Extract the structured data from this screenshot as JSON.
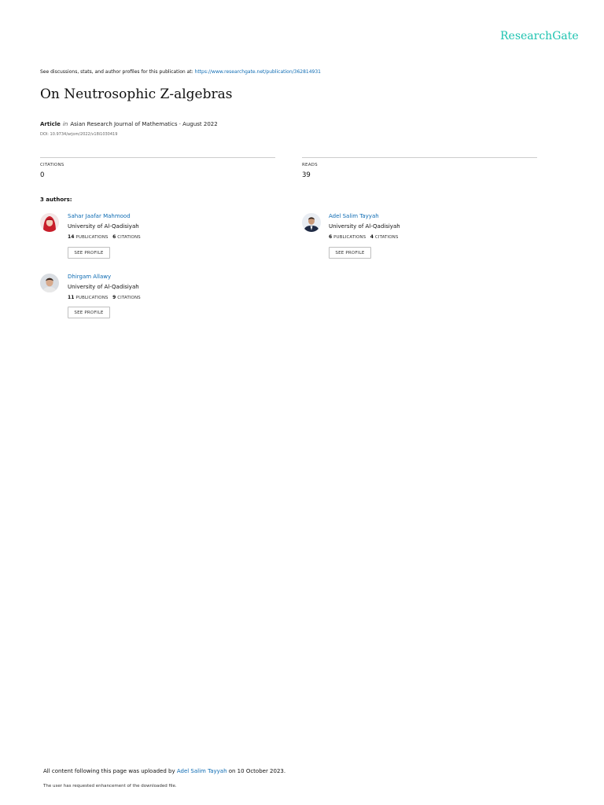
{
  "brand": {
    "logo_text": "ResearchGate",
    "color": "#1ec3b0"
  },
  "discussion": {
    "prefix": "See discussions, stats, and author profiles for this publication at: ",
    "url": "https://www.researchgate.net/publication/362814931"
  },
  "publication": {
    "title": "On Neutrosophic Z-algebras",
    "type": "Article",
    "in_word": "in",
    "journal_date": "Asian Research Journal of Mathematics · August 2022",
    "doi": "DOI: 10.9734/arjom/2022/v18i1030419"
  },
  "stats": {
    "citations": {
      "label": "CITATIONS",
      "value": "0"
    },
    "reads": {
      "label": "READS",
      "value": "39"
    }
  },
  "authors_heading": "3 authors:",
  "authors": [
    {
      "name": "Sahar Jaafar Mahmood",
      "university": "University of Al-Qadisiyah",
      "publications": "14",
      "publications_label": "PUBLICATIONS",
      "citations": "6",
      "citations_label": "CITATIONS",
      "button": "SEE PROFILE"
    },
    {
      "name": "Adel Salim Tayyah",
      "university": "University of Al-Qadisiyah",
      "publications": "6",
      "publications_label": "PUBLICATIONS",
      "citations": "4",
      "citations_label": "CITATIONS",
      "button": "SEE PROFILE"
    },
    {
      "name": "Dhirgam Allawy",
      "university": "University of Al-Qadisiyah",
      "publications": "11",
      "publications_label": "PUBLICATIONS",
      "citations": "9",
      "citations_label": "CITATIONS",
      "button": "SEE PROFILE"
    }
  ],
  "footer": {
    "uploaded_prefix": "All content following this page was uploaded by ",
    "uploader": "Adel Salim Tayyah",
    "uploaded_suffix": " on 10 October 2023.",
    "note": "The user has requested enhancement of the downloaded file."
  }
}
